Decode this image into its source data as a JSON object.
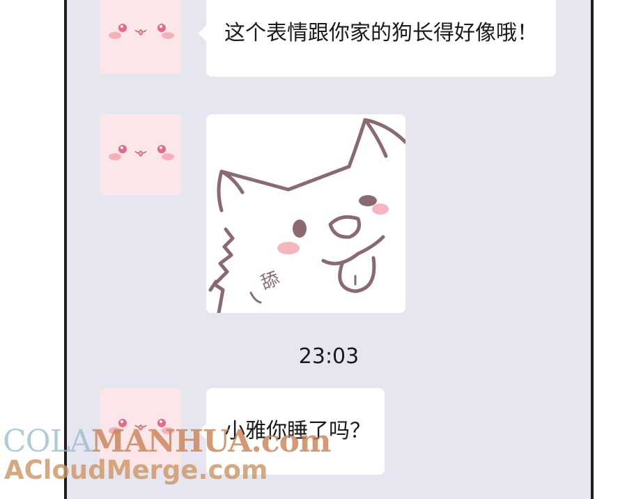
{
  "chat": {
    "messages": [
      {
        "text": "这个表情跟你家的狗长得好像哦！"
      },
      {
        "sticker": "cartoon-dog-tongue-out",
        "sticker_text": "舔"
      },
      {
        "text": "小雅你睡了吗？"
      }
    ],
    "timestamp": "23:03"
  },
  "watermark": {
    "line1_part1": "COLA",
    "line1_part2": "MANHUA.com",
    "line2": "ACloudMerge.com"
  },
  "colors": {
    "chat_background": "#e6e6f0",
    "bubble": "#ffffff",
    "avatar_background": "#fbe7ea",
    "sticker_line": "#8a6a6e"
  }
}
